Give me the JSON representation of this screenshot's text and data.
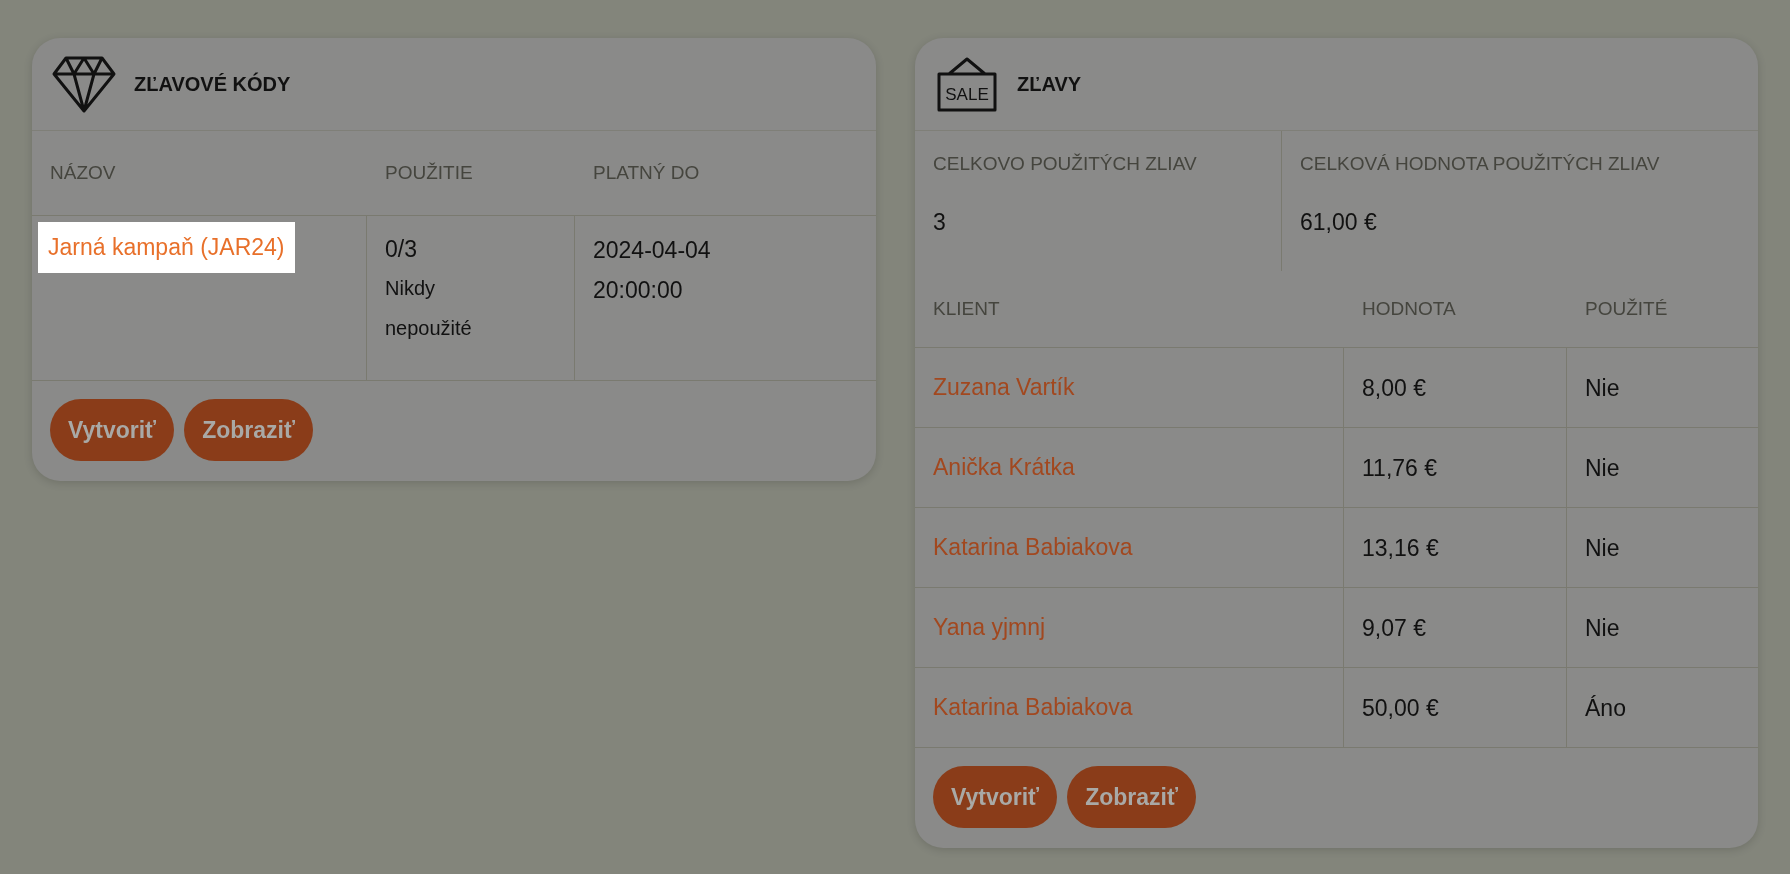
{
  "discount_codes": {
    "title": "ZĽAVOVÉ KÓDY",
    "columns": [
      "NÁZOV",
      "POUŽITIE",
      "PLATNÝ DO"
    ],
    "rows": [
      {
        "name": "Jarná kampaň (JAR24)",
        "highlighted": true,
        "usage": "0/3",
        "usage_note": "Nikdy nepoužité",
        "valid_until": "2024-04-04 20:00:00"
      }
    ],
    "buttons": [
      "Vytvoriť",
      "Zobraziť"
    ]
  },
  "discounts": {
    "icon_text": "SALE",
    "title": "ZĽAVY",
    "stats": [
      {
        "label": "CELKOVO POUŽITÝCH ZLIAV",
        "value": "3"
      },
      {
        "label": "CELKOVÁ HODNOTA POUŽITÝCH ZLIAV",
        "value": "61,00 €"
      }
    ],
    "columns": [
      "KLIENT",
      "HODNOTA",
      "POUŽITÉ"
    ],
    "rows": [
      {
        "client": "Zuzana Vartík",
        "value": "8,00 €",
        "used": "Nie"
      },
      {
        "client": "Anička Krátka",
        "value": "11,76 €",
        "used": "Nie"
      },
      {
        "client": "Katarina Babiakova",
        "value": "13,16 €",
        "used": "Nie"
      },
      {
        "client": "Yana yjmnj",
        "value": "9,07 €",
        "used": "Nie"
      },
      {
        "client": "Katarina Babiakova",
        "value": "50,00 €",
        "used": "Áno"
      }
    ],
    "buttons": [
      "Vytvoriť",
      "Zobraziť"
    ]
  }
}
